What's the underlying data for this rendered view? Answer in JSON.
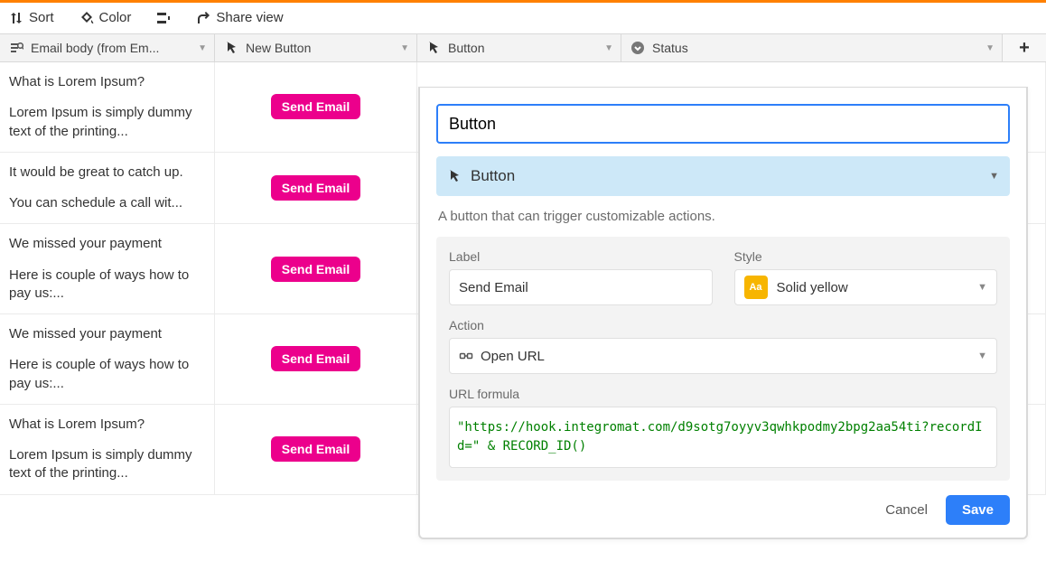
{
  "toolbar": {
    "sort": "Sort",
    "color": "Color",
    "share": "Share view"
  },
  "columns": {
    "a": "Email body (from Em...",
    "b": "New Button",
    "c": "Button",
    "d": "Status"
  },
  "button_label": "Send Email",
  "rows": [
    {
      "l1": "What is Lorem Ipsum?",
      "l2": "Lorem Ipsum is simply dummy text of the printing..."
    },
    {
      "l1": "It would be great to catch up.",
      "l2": "You can schedule a call wit..."
    },
    {
      "l1": "We missed your payment",
      "l2": "Here is couple of ways how to pay us:..."
    },
    {
      "l1": "We missed your payment",
      "l2": "Here is couple of ways how to pay us:..."
    },
    {
      "l1": "What is Lorem Ipsum?",
      "l2": "Lorem Ipsum is simply dummy text of the printing..."
    }
  ],
  "popover": {
    "field_name": "Button",
    "type_label": "Button",
    "description": "A button that can trigger customizable actions.",
    "label_label": "Label",
    "label_value": "Send Email",
    "style_label": "Style",
    "style_value": "Solid yellow",
    "action_label": "Action",
    "action_value": "Open URL",
    "url_label": "URL formula",
    "url_formula": "\"https://hook.integromat.com/d9sotg7oyyv3qwhkpodmy2bpg2aa54ti?recordId=\" & RECORD_ID()",
    "cancel": "Cancel",
    "save": "Save"
  }
}
